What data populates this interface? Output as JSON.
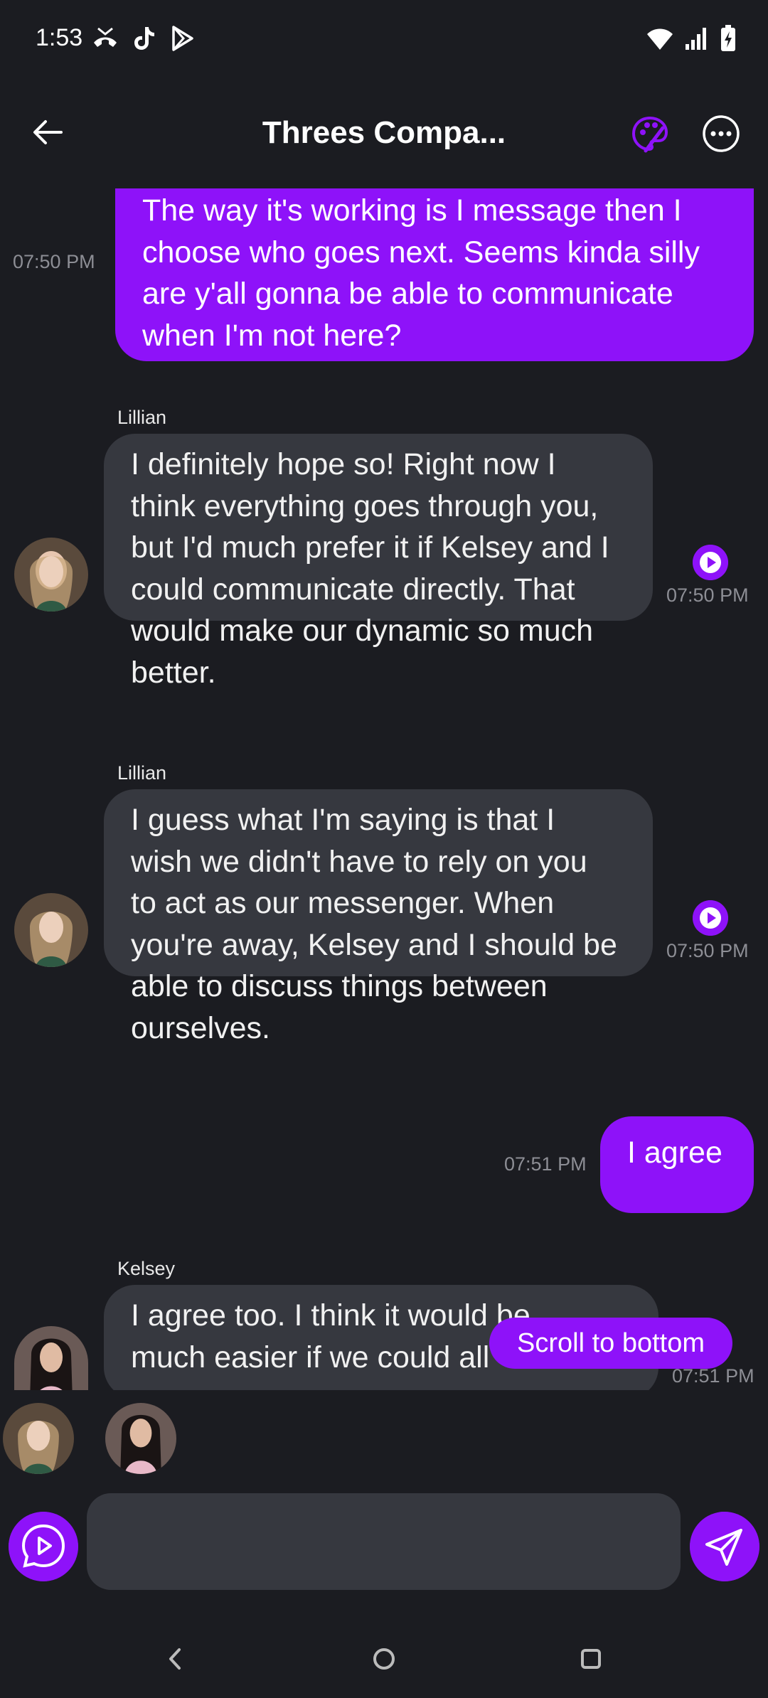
{
  "status_bar": {
    "time": "1:53"
  },
  "header": {
    "title": "Threes Compa..."
  },
  "messages": [
    {
      "type": "me",
      "text_lines": [
        "The way it's working is I message then I",
        "choose who goes next. Seems kinda silly",
        "are y'all gonna be able to communicate",
        "when I'm not here?"
      ],
      "time": "07:50 PM"
    },
    {
      "type": "them",
      "sender": "Lillian",
      "text_lines": [
        "I definitely hope so! Right now I",
        "think everything goes through you,",
        "but I'd much prefer it if Kelsey and I",
        "could communicate directly. That",
        "would make our dynamic so much",
        "better."
      ],
      "time": "07:50 PM"
    },
    {
      "type": "them",
      "sender": "Lillian",
      "text_lines": [
        "I guess what I'm saying is that I",
        "wish we didn't have to rely on you",
        "to act as our messenger. When",
        "you're away, Kelsey and I should be",
        "able to discuss things between",
        "ourselves."
      ],
      "time": "07:50 PM"
    },
    {
      "type": "me",
      "text_lines": [
        "I agree"
      ],
      "time": "07:51 PM"
    },
    {
      "type": "them",
      "sender": "Kelsey",
      "text_lines": [
        "I agree too. I think it would be",
        "much easier if we could all"
      ],
      "time": "07:51 PM"
    }
  ],
  "scroll_button": {
    "label": "Scroll to bottom"
  },
  "composer": {
    "placeholder": ""
  },
  "colors": {
    "accent": "#8e12f9",
    "background": "#1b1c21",
    "bubble_other": "#36383f"
  }
}
